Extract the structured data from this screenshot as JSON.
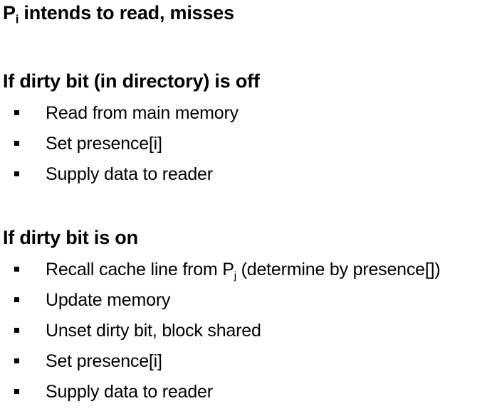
{
  "title": {
    "proc_letter": "P",
    "proc_sub": "i",
    "rest": " intends to read, misses"
  },
  "section_off": {
    "heading": "If dirty bit (in directory) is off",
    "bullet_glyph": "square-bullet-icon",
    "items": [
      "Read from main memory",
      "Set presence[i]",
      "Supply data to reader"
    ]
  },
  "section_on": {
    "heading": "If dirty bit is on",
    "recall": {
      "before": "Recall cache line from P",
      "sub": "j",
      "after": " (determine by presence[])"
    },
    "items": [
      "Update memory",
      "Unset dirty bit, block shared",
      "Set presence[i]",
      "Supply data to reader"
    ]
  }
}
